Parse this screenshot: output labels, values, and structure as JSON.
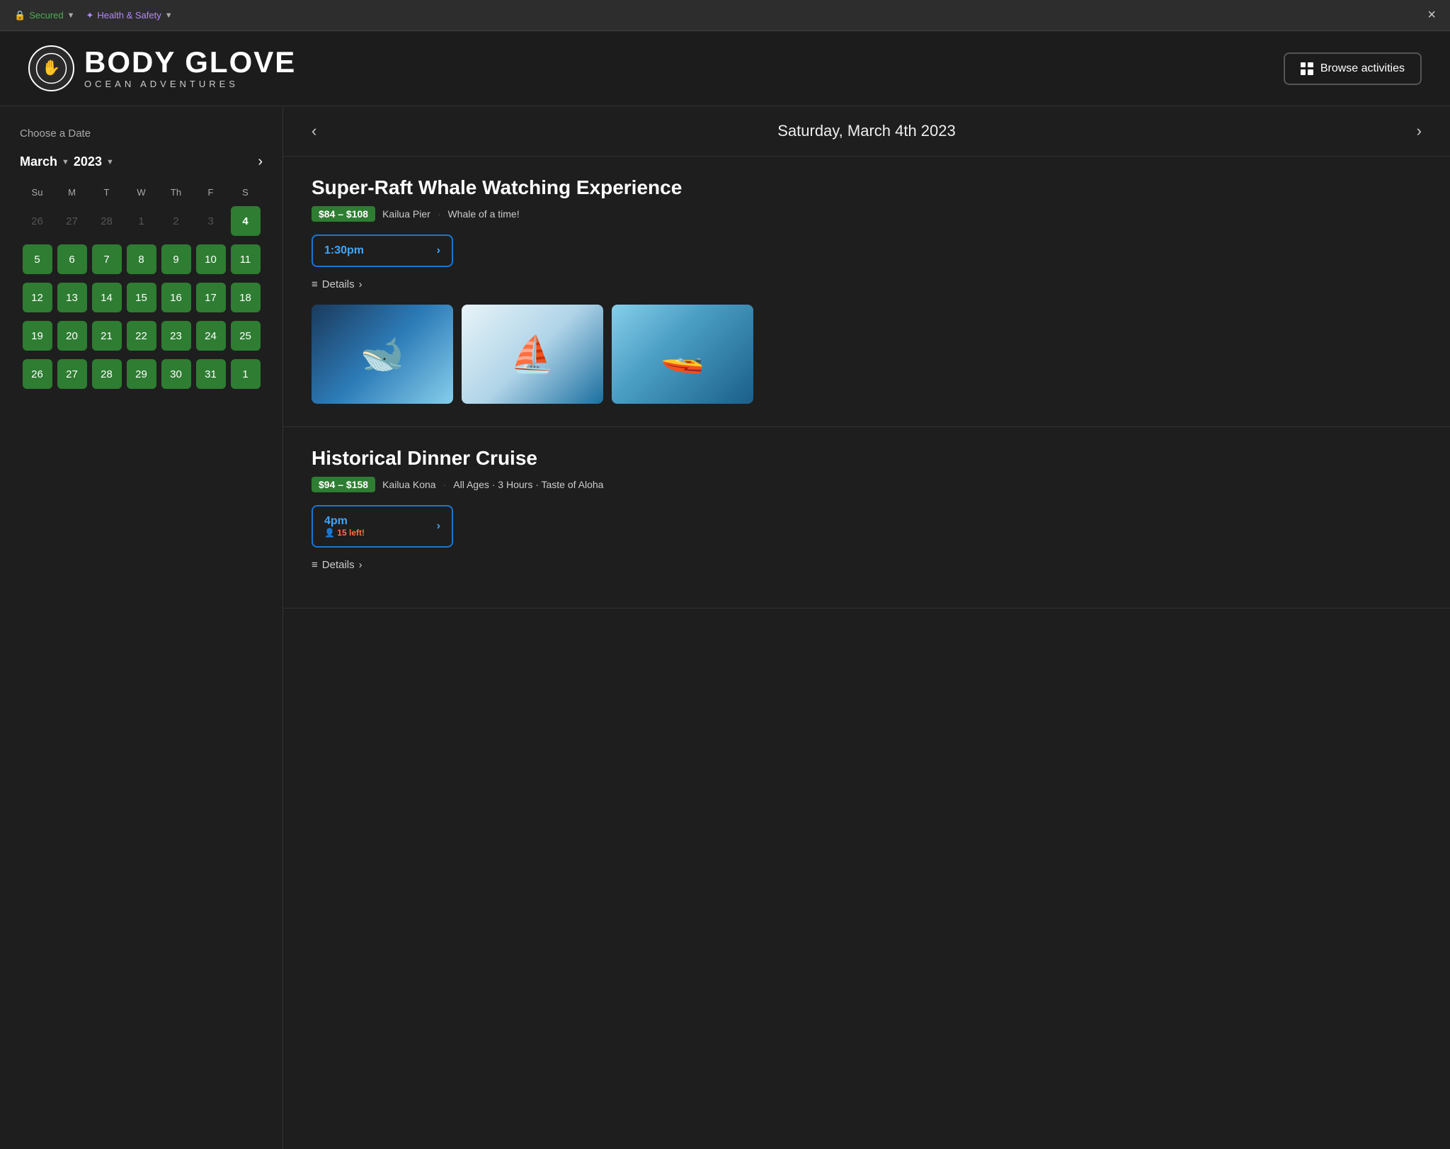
{
  "browser": {
    "secure_label": "Secured",
    "health_label": "Health & Safety",
    "close_label": "×"
  },
  "header": {
    "brand_name": "BODY GLOVE",
    "brand_sub": "OCEAN ADVENTURES",
    "browse_btn": "Browse activities"
  },
  "calendar": {
    "choose_label": "Choose a Date",
    "month": "March",
    "year": "2023",
    "days_header": [
      "Su",
      "M",
      "T",
      "W",
      "Th",
      "F",
      "S"
    ],
    "weeks": [
      [
        {
          "label": "26",
          "type": "inactive"
        },
        {
          "label": "27",
          "type": "inactive"
        },
        {
          "label": "28",
          "type": "inactive"
        },
        {
          "label": "1",
          "type": "inactive"
        },
        {
          "label": "2",
          "type": "inactive"
        },
        {
          "label": "3",
          "type": "inactive"
        },
        {
          "label": "4",
          "type": "selected"
        }
      ],
      [
        {
          "label": "5",
          "type": "available"
        },
        {
          "label": "6",
          "type": "available"
        },
        {
          "label": "7",
          "type": "available"
        },
        {
          "label": "8",
          "type": "available"
        },
        {
          "label": "9",
          "type": "available"
        },
        {
          "label": "10",
          "type": "available"
        },
        {
          "label": "11",
          "type": "available"
        }
      ],
      [
        {
          "label": "12",
          "type": "available"
        },
        {
          "label": "13",
          "type": "available"
        },
        {
          "label": "14",
          "type": "available"
        },
        {
          "label": "15",
          "type": "available"
        },
        {
          "label": "16",
          "type": "available"
        },
        {
          "label": "17",
          "type": "available"
        },
        {
          "label": "18",
          "type": "available"
        }
      ],
      [
        {
          "label": "19",
          "type": "available"
        },
        {
          "label": "20",
          "type": "available"
        },
        {
          "label": "21",
          "type": "available"
        },
        {
          "label": "22",
          "type": "available"
        },
        {
          "label": "23",
          "type": "available"
        },
        {
          "label": "24",
          "type": "available"
        },
        {
          "label": "25",
          "type": "available"
        }
      ],
      [
        {
          "label": "26",
          "type": "available"
        },
        {
          "label": "27",
          "type": "available"
        },
        {
          "label": "28",
          "type": "available"
        },
        {
          "label": "29",
          "type": "available"
        },
        {
          "label": "30",
          "type": "available"
        },
        {
          "label": "31",
          "type": "available"
        },
        {
          "label": "1",
          "type": "available"
        }
      ]
    ]
  },
  "date_nav": {
    "date_display": "Saturday, March 4th 2023",
    "prev_label": "‹",
    "next_label": "›"
  },
  "activities": [
    {
      "title": "Super-Raft Whale Watching Experience",
      "price": "$84 – $108",
      "location": "Kailua Pier",
      "tagline": "Whale of a time!",
      "time": "1:30pm",
      "details_label": "Details",
      "images": [
        "whale-breach",
        "boat-people",
        "raft-open"
      ]
    },
    {
      "title": "Historical Dinner Cruise",
      "price": "$94 – $158",
      "location": "Kailua Kona",
      "tagline": "All Ages · 3 Hours · Taste of Aloha",
      "time": "4pm",
      "seats_left": "15 left!",
      "details_label": "Details"
    }
  ]
}
